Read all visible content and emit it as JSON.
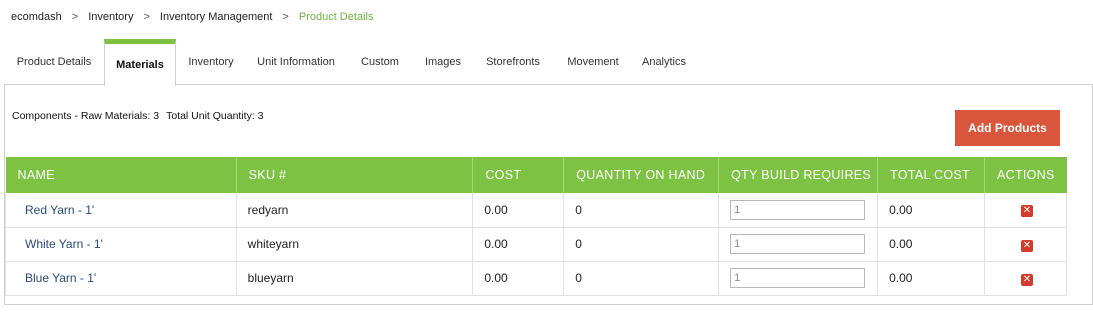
{
  "breadcrumb": [
    "ecomdash",
    "Inventory",
    "Inventory Management",
    "Product Details"
  ],
  "tabs": [
    "Product Details",
    "Materials",
    "Inventory",
    "Unit Information",
    "Custom",
    "Images",
    "Storefronts",
    "Movement",
    "Analytics"
  ],
  "active_tab": "Materials",
  "summary": {
    "components": "Components - Raw Materials: 3",
    "total_qty": "Total Unit Quantity: 3"
  },
  "add_button": "Add Products",
  "table": {
    "headers": [
      "NAME",
      "SKU #",
      "COST",
      "QUANTITY ON HAND",
      "QTY BUILD REQUIRES",
      "TOTAL COST",
      "ACTIONS"
    ],
    "rows": [
      {
        "name": "Red Yarn - 1'",
        "sku": "redyarn",
        "cost": "0.00",
        "qoh": "0",
        "qty_build": "1",
        "total_cost": "0.00"
      },
      {
        "name": "White Yarn - 1'",
        "sku": "whiteyarn",
        "cost": "0.00",
        "qoh": "0",
        "qty_build": "1",
        "total_cost": "0.00"
      },
      {
        "name": "Blue Yarn - 1'",
        "sku": "blueyarn",
        "cost": "0.00",
        "qoh": "0",
        "qty_build": "1",
        "total_cost": "0.00"
      }
    ]
  },
  "colors": {
    "accent_green": "#7dc243",
    "breadcrumb_active": "#6db33f",
    "button_red": "#d9563c",
    "delete_red": "#d63a2b"
  },
  "icons": {
    "delete": "close-x-icon"
  }
}
